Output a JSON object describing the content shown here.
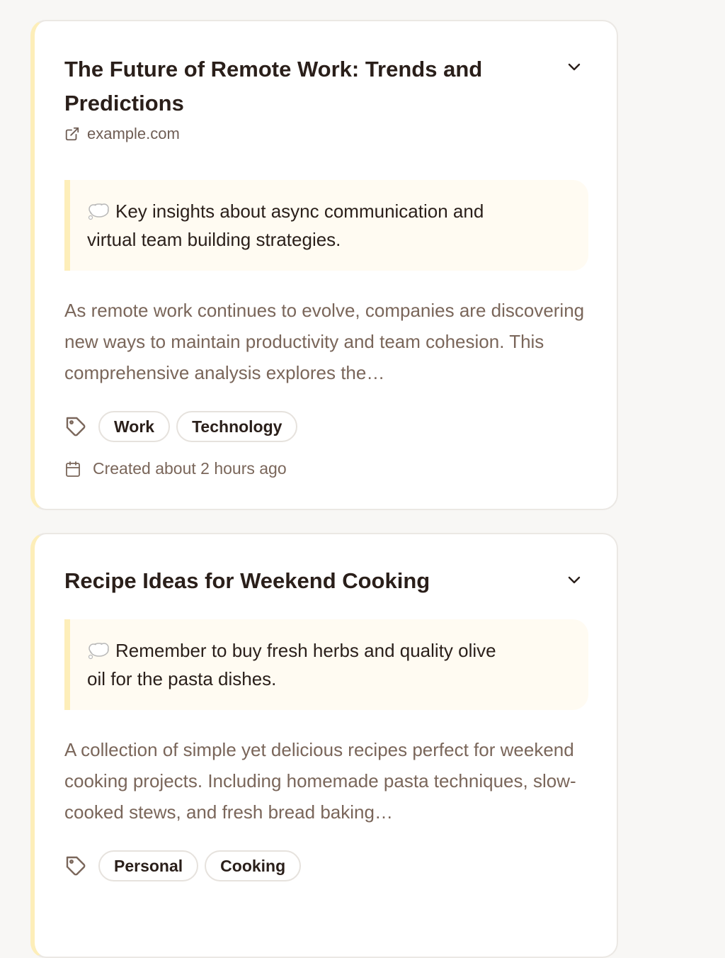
{
  "cards": [
    {
      "title": "The Future of Remote Work: Trends and Predictions",
      "source": "example.com",
      "note_emoji": "thought-bubble",
      "note": "Key insights about async communication and virtual team building strategies.",
      "description": "As remote work continues to evolve, companies are discovering new ways to maintain productivity and team cohesion. This comprehensive analysis explores the…",
      "tags": [
        "Work",
        "Technology"
      ],
      "created": "Created about 2 hours ago",
      "icons": [
        "external-link-icon",
        "chevron-down-icon",
        "tag-icon",
        "calendar-icon"
      ]
    },
    {
      "title": "Recipe Ideas for Weekend Cooking",
      "note_emoji": "thought-bubble",
      "note": "Remember to buy fresh herbs and quality olive oil for the pasta dishes.",
      "description": "A collection of simple yet delicious recipes perfect for weekend cooking projects. Including homemade pasta techniques, slow-cooked stews, and fresh bread baking…",
      "tags": [
        "Personal",
        "Cooking"
      ],
      "icons": [
        "chevron-down-icon",
        "tag-icon"
      ]
    }
  ],
  "colors": {
    "background": "#f8f7f5",
    "card_accent": "#fdeeb9",
    "note_background": "#fffbf2",
    "title_text": "#2a1f1a",
    "muted_text": "#7a665a"
  }
}
